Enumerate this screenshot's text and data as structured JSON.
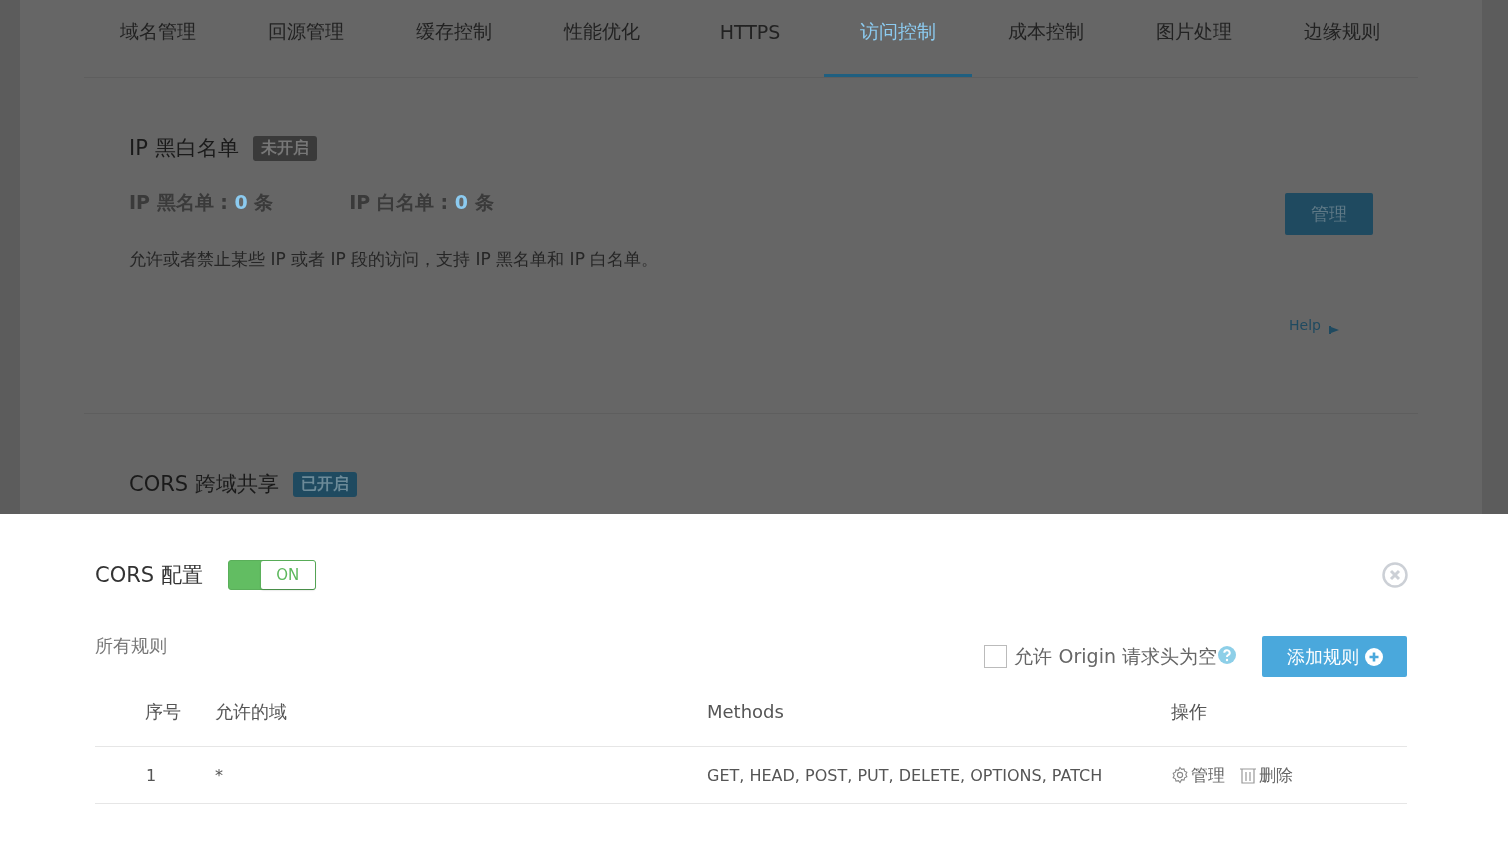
{
  "tabs": [
    {
      "label": "域名管理",
      "selected": false
    },
    {
      "label": "回源管理",
      "selected": false
    },
    {
      "label": "缓存控制",
      "selected": false
    },
    {
      "label": "性能优化",
      "selected": false
    },
    {
      "label": "HTTPS",
      "selected": false
    },
    {
      "label": "访问控制",
      "selected": true
    },
    {
      "label": "成本控制",
      "selected": false
    },
    {
      "label": "图片处理",
      "selected": false
    },
    {
      "label": "边缘规则",
      "selected": false
    }
  ],
  "ip_section": {
    "title": "IP 黑白名单",
    "status": {
      "label": "未开启",
      "enabled": false
    },
    "counts": [
      {
        "label": "IP 黑名单 :",
        "value": "0",
        "unit": "条"
      },
      {
        "label": "IP 白名单 :",
        "value": "0",
        "unit": "条"
      }
    ],
    "description": "允许或者禁止某些 IP 或者 IP 段的访问，支持 IP 黑名单和 IP 白名单。",
    "manage_button": "管理",
    "help_link": "Help"
  },
  "cors_section": {
    "title": "CORS 跨域共享",
    "status": {
      "label": "已开启",
      "enabled": true
    }
  },
  "drawer": {
    "title": "CORS 配置",
    "toggle": {
      "label": "ON",
      "on": true
    },
    "rules_label": "所有规则",
    "allow_empty_origin": {
      "label": "允许 Origin 请求头为空",
      "checked": false
    },
    "add_button": "添加规则",
    "table": {
      "columns": [
        "序号",
        "允许的域",
        "Methods",
        "操作"
      ],
      "rows": [
        {
          "index": "1",
          "domain": "*",
          "methods": "GET, HEAD, POST, PUT, DELETE, OPTIONS, PATCH",
          "actions": [
            {
              "kind": "settings",
              "label": "管理"
            },
            {
              "kind": "delete",
              "label": "删除"
            }
          ]
        }
      ]
    }
  }
}
